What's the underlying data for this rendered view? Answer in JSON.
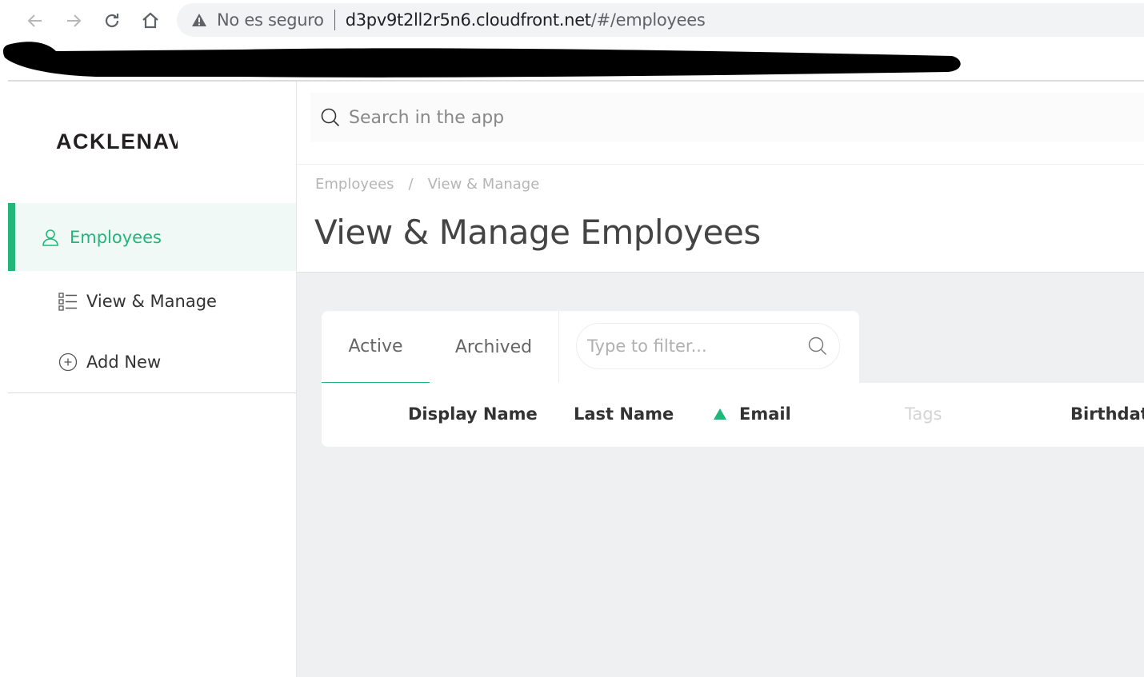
{
  "browser": {
    "security_label": "No es seguro",
    "url_host": "d3pv9t2ll2r5n6.cloudfront.net",
    "url_path": "/#/employees"
  },
  "app": {
    "search_placeholder": "Search in the app",
    "logo_text": "ACKLENAVENUE"
  },
  "sidebar": {
    "section_label": "Employees",
    "items": [
      {
        "label": "View & Manage",
        "icon": "list-icon"
      },
      {
        "label": "Add New",
        "icon": "plus-circle-icon"
      }
    ]
  },
  "breadcrumb": {
    "items": [
      "Employees",
      "/",
      "View & Manage"
    ]
  },
  "page": {
    "title": "View & Manage Employees"
  },
  "tabs": [
    {
      "label": "Active",
      "active": true
    },
    {
      "label": "Archived",
      "active": false
    }
  ],
  "filter": {
    "placeholder": "Type to filter..."
  },
  "table": {
    "columns": [
      "Display Name",
      "Last Name",
      "Email",
      "Tags",
      "Birthdate"
    ],
    "sorted_column": "Email",
    "sort_direction": "ascending"
  },
  "colors": {
    "accent": "#21b67a",
    "background": "#eef0f1"
  }
}
